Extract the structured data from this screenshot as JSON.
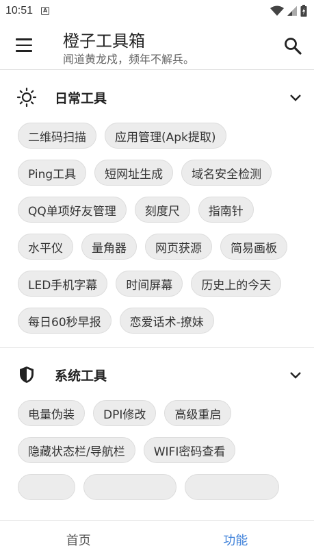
{
  "status_bar": {
    "time": "10:51",
    "notification_icon": "A",
    "icons": [
      "wifi-icon",
      "signal-icon",
      "battery-icon"
    ]
  },
  "app_bar": {
    "title": "橙子工具箱",
    "subtitle": "闻道黄龙戍，频年不解兵。"
  },
  "sections": [
    {
      "icon": "sun-icon",
      "title": "日常工具",
      "items": [
        "二维码扫描",
        "应用管理(Apk提取)",
        "Ping工具",
        "短网址生成",
        "域名安全检测",
        "QQ单项好友管理",
        "刻度尺",
        "指南针",
        "水平仪",
        "量角器",
        "网页获源",
        "简易画板",
        "LED手机字幕",
        "时间屏幕",
        "历史上的今天",
        "每日60秒早报",
        "恋爱话术-撩妹"
      ]
    },
    {
      "icon": "shield-icon",
      "title": "系统工具",
      "items": [
        "电量伪装",
        "DPI修改",
        "高级重启",
        "隐藏状态栏/导航栏",
        "WIFI密码查看",
        "",
        "",
        ""
      ]
    }
  ],
  "bottom_nav": {
    "tabs": [
      {
        "label": "首页",
        "active": false
      },
      {
        "label": "功能",
        "active": true
      }
    ],
    "active_color": "#3b7fd9"
  }
}
